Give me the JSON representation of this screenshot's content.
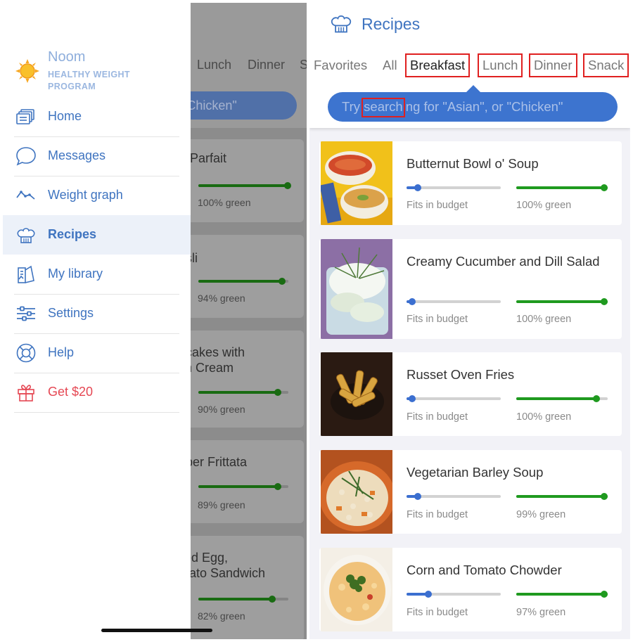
{
  "menu": {
    "brand_name": "Noom",
    "brand_subtitle": "HEALTHY WEIGHT PROGRAM",
    "items": [
      {
        "label": "Home",
        "icon": "home-icon"
      },
      {
        "label": "Messages",
        "icon": "chat-bubble-icon"
      },
      {
        "label": "Weight graph",
        "icon": "weight-graph-icon"
      },
      {
        "label": "Recipes",
        "icon": "chef-hat-icon"
      },
      {
        "label": "My library",
        "icon": "library-icon"
      },
      {
        "label": "Settings",
        "icon": "sliders-icon"
      },
      {
        "label": "Help",
        "icon": "lifebuoy-icon"
      },
      {
        "label": "Get $20",
        "icon": "gift-icon"
      }
    ],
    "active_item": "Recipes"
  },
  "background_list": {
    "tabs": [
      "Lunch",
      "Dinner",
      "S"
    ],
    "search_text": "r \"Chicken\"",
    "cards": [
      {
        "title_lines": [
          "rt Parfait"
        ],
        "green": "100% green"
      },
      {
        "title_lines": [
          "esli"
        ],
        "green": "94% green"
      },
      {
        "title_lines": [
          "ncakes with",
          "sh Cream"
        ],
        "green": "90% green"
      },
      {
        "title_lines": [
          "pper Frittata"
        ],
        "green": "89% green"
      },
      {
        "title_lines": [
          "iled Egg,",
          "mato Sandwich"
        ],
        "green": "82% green"
      }
    ]
  },
  "recipes": {
    "title": "Recipes",
    "tabs": [
      "Favorites",
      "All",
      "Breakfast",
      "Lunch",
      "Dinner",
      "Snack"
    ],
    "selected_tab": "Breakfast",
    "search_placeholder": "Try searching for \"Asian\", or \"Chicken\"",
    "budget_label": "Fits in budget",
    "colors": {
      "accent": "#3d74cf",
      "budget": "#3b6fd0",
      "green": "#1f9a1f",
      "gift": "#e54753"
    },
    "cards": [
      {
        "title": "Butternut Bowl o' Soup",
        "budget": 0.12,
        "green": 1.0,
        "green_label": "100% green"
      },
      {
        "title": "Creamy Cucumber and Dill Salad",
        "budget": 0.06,
        "green": 1.0,
        "green_label": "100% green"
      },
      {
        "title": "Russet Oven Fries",
        "budget": 0.06,
        "green": 0.88,
        "green_label": "100% green"
      },
      {
        "title": "Vegetarian Barley Soup",
        "budget": 0.12,
        "green": 1.0,
        "green_label": "99% green"
      },
      {
        "title": "Corn and Tomato Chowder",
        "budget": 0.23,
        "green": 1.0,
        "green_label": "97% green"
      }
    ]
  }
}
